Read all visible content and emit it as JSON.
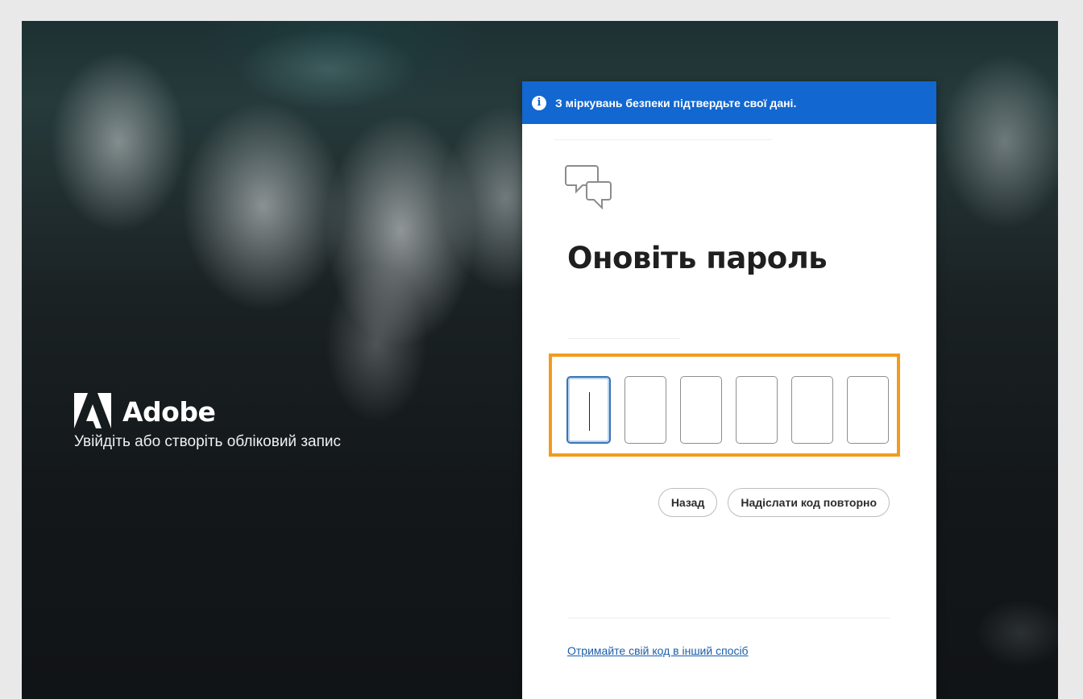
{
  "brand": {
    "name": "Adobe",
    "tagline": "Увійдіть або створіть обліковий запис"
  },
  "notice": {
    "icon": "info-icon",
    "text": "З міркувань безпеки підтвердьте свої дані.",
    "color": "#1267d0"
  },
  "dialog": {
    "icon": "chat-bubbles-icon",
    "title": "Оновіть пароль",
    "code_digits": [
      "",
      "",
      "",
      "",
      "",
      ""
    ],
    "active_digit": 1,
    "highlight_color": "#f19c1f",
    "buttons": {
      "back": "Назад",
      "resend": "Надіслати код повторно"
    },
    "alt_link": "Отримайте свій код в інший спосіб"
  }
}
